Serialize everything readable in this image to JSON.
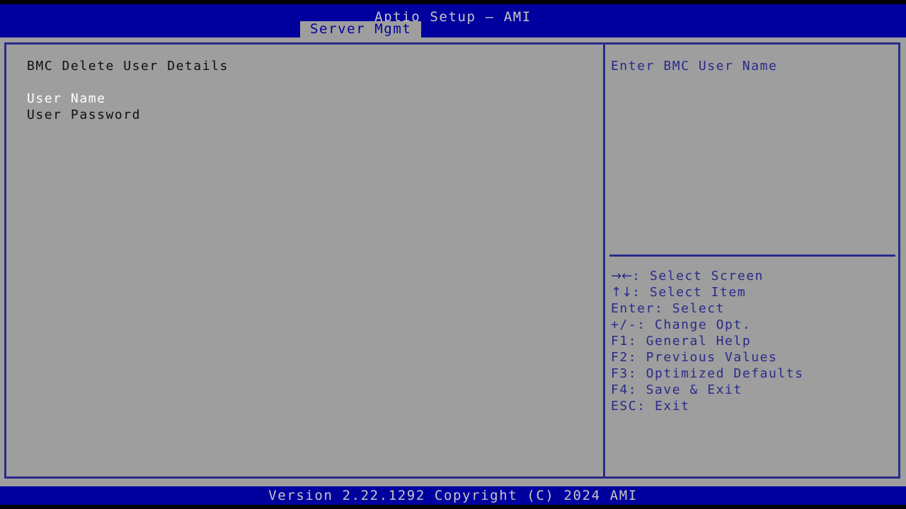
{
  "header": {
    "title": "Aptio Setup – AMI",
    "tabs": [
      {
        "label": "Server Mgmt",
        "active": true
      }
    ]
  },
  "main": {
    "section_title": "BMC Delete User Details",
    "items": [
      {
        "label": "User Name",
        "selected": true
      },
      {
        "label": "User Password",
        "selected": false
      }
    ]
  },
  "help": {
    "description": "Enter BMC User Name",
    "nav": [
      {
        "key_glyph": "→←",
        "key_text": "",
        "separator": ": ",
        "action": "Select Screen"
      },
      {
        "key_glyph": "↑↓",
        "key_text": "",
        "separator": ": ",
        "action": "Select Item"
      },
      {
        "key_glyph": "",
        "key_text": "Enter",
        "separator": ": ",
        "action": "Select"
      },
      {
        "key_glyph": "",
        "key_text": "+/-",
        "separator": ": ",
        "action": "Change Opt."
      },
      {
        "key_glyph": "",
        "key_text": "F1",
        "separator": ": ",
        "action": "General Help"
      },
      {
        "key_glyph": "",
        "key_text": "F2",
        "separator": ": ",
        "action": "Previous Values"
      },
      {
        "key_glyph": "",
        "key_text": "F3",
        "separator": ": ",
        "action": "Optimized Defaults"
      },
      {
        "key_glyph": "",
        "key_text": "F4",
        "separator": ": ",
        "action": "Save & Exit"
      },
      {
        "key_glyph": "",
        "key_text": "ESC",
        "separator": ": ",
        "action": "Exit"
      }
    ]
  },
  "footer": {
    "version_text": "Version 2.22.1292 Copyright (C) 2024 AMI"
  },
  "colors": {
    "header_blue": "#00009e",
    "body_gray": "#9e9e9e",
    "border_blue": "#2a2a8c",
    "help_text_blue": "#2a2a8c",
    "label_black": "#101010",
    "selected_white": "#ffffff",
    "title_gray": "#c6c6c6",
    "outer_black": "#000000"
  }
}
